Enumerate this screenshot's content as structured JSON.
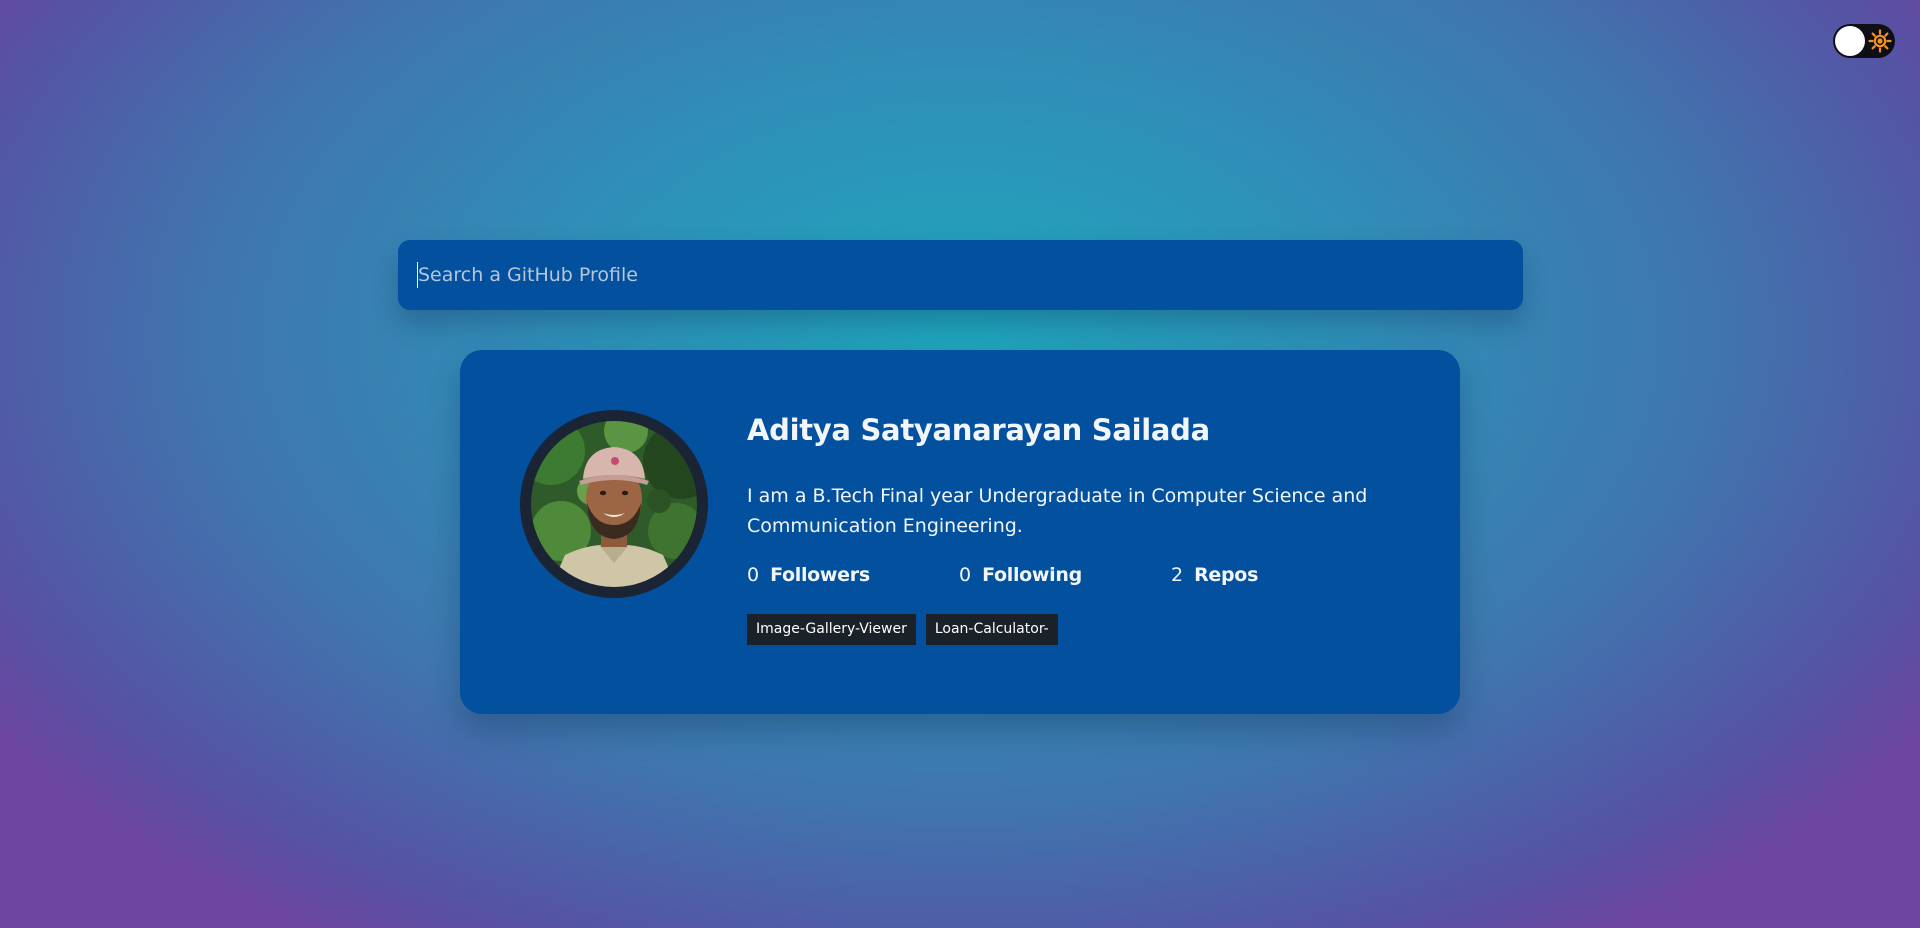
{
  "search": {
    "placeholder": "Search a GitHub Profile",
    "value": ""
  },
  "theme_toggle": {
    "state": "light",
    "icon": "sun-icon"
  },
  "profile": {
    "name": "Aditya Satyanarayan Sailada",
    "bio": "I am a B.Tech Final year Undergraduate in Computer Science and Communication Engineering.",
    "stats": [
      {
        "count": "0",
        "label": "Followers"
      },
      {
        "count": "0",
        "label": "Following"
      },
      {
        "count": "2",
        "label": "Repos"
      }
    ],
    "repos": [
      "Image-Gallery-Viewer",
      "Loan-Calculator-"
    ]
  },
  "colors": {
    "card": "#02509e",
    "search": "#02509e",
    "repo_tag": "#1b2128",
    "avatar_ring": "#1a2434",
    "sun": "#f6921e"
  }
}
